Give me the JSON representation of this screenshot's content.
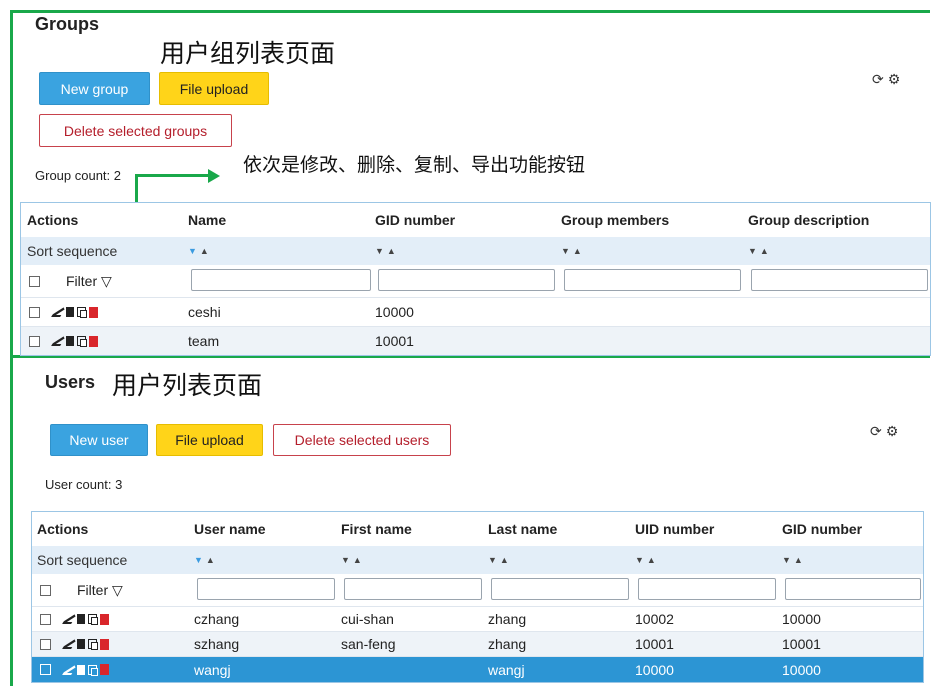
{
  "annotations": {
    "groups_note": "用户组列表页面",
    "buttons_note": "依次是修改、删除、复制、导出功能按钮",
    "users_note": "用户列表页面"
  },
  "toolbar_icons": [
    "refresh-icon",
    "gear-icon"
  ],
  "groups": {
    "title": "Groups",
    "new_button": "New group",
    "upload_button": "File upload",
    "delete_button": "Delete selected groups",
    "count_label": "Group count: 2",
    "columns": [
      "Actions",
      "Name",
      "GID number",
      "Group members",
      "Group description"
    ],
    "sort_label": "Sort sequence",
    "filter_label": "Filter ▽",
    "rows": [
      {
        "name": "ceshi",
        "gid": "10000",
        "members": "",
        "description": ""
      },
      {
        "name": "team",
        "gid": "10001",
        "members": "",
        "description": ""
      }
    ]
  },
  "users": {
    "title": "Users",
    "new_button": "New user",
    "upload_button": "File upload",
    "delete_button": "Delete selected users",
    "count_label": "User count: 3",
    "columns": [
      "Actions",
      "User name",
      "First name",
      "Last name",
      "UID number",
      "GID number"
    ],
    "sort_label": "Sort sequence",
    "filter_label": "Filter ▽",
    "rows": [
      {
        "username": "czhang",
        "first": "cui-shan",
        "last": "zhang",
        "uid": "10002",
        "gid": "10000",
        "selected": false
      },
      {
        "username": "szhang",
        "first": "san-feng",
        "last": "zhang",
        "uid": "10001",
        "gid": "10001",
        "selected": false
      },
      {
        "username": "wangj",
        "first": "",
        "last": "wangj",
        "uid": "10000",
        "gid": "10000",
        "selected": true
      }
    ]
  },
  "colors": {
    "annotation_green": "#19a84a",
    "primary_blue": "#3aa3e0",
    "upload_yellow": "#ffd419",
    "danger_red": "#b41e2b",
    "selected_row": "#2c95d4"
  }
}
